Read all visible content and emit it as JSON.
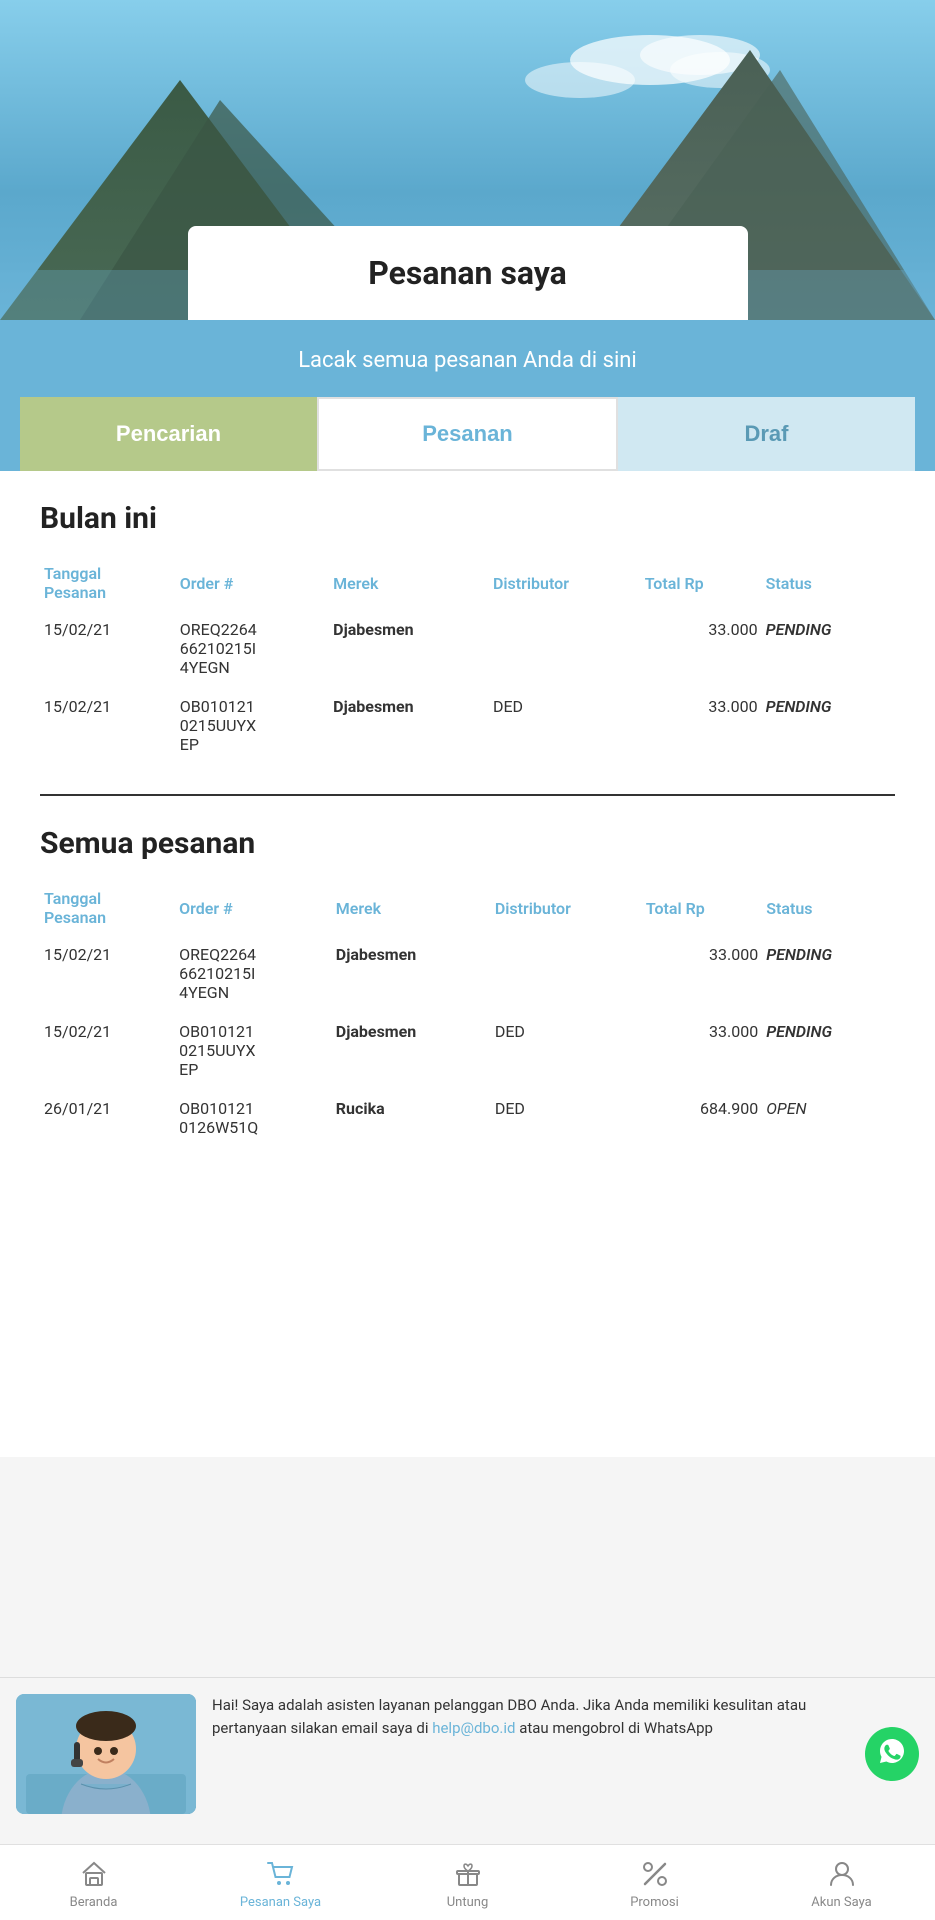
{
  "hero": {
    "title": "Pesanan saya",
    "subtitle": "Lacak semua pesanan Anda di sini"
  },
  "tabs": [
    {
      "id": "pencarian",
      "label": "Pencarian",
      "active": true
    },
    {
      "id": "pesanan",
      "label": "Pesanan",
      "active": false
    },
    {
      "id": "draf",
      "label": "Draf",
      "active": false
    }
  ],
  "sections": [
    {
      "title": "Bulan ini",
      "columns": [
        "Tanggal Pesanan",
        "Order #",
        "Merek",
        "Distributor",
        "Total Rp",
        "Status"
      ],
      "rows": [
        {
          "date": "15/02/21",
          "order_id": "OREQ226466210215I4YEGN",
          "brand": "Djabesmen",
          "distributor": "",
          "total": "33.000",
          "status": "PENDING",
          "status_class": "pending"
        },
        {
          "date": "15/02/21",
          "order_id": "OB0101210215UUYXEP",
          "brand": "Djabesmen",
          "distributor": "DED",
          "total": "33.000",
          "status": "PENDING",
          "status_class": "pending"
        }
      ]
    },
    {
      "title": "Semua pesanan",
      "columns": [
        "Tanggal Pesanan",
        "Order #",
        "Merek",
        "Distributor",
        "Total Rp",
        "Status"
      ],
      "rows": [
        {
          "date": "15/02/21",
          "order_id": "OREQ226466210215I4YEGN",
          "brand": "Djabesmen",
          "distributor": "",
          "total": "33.000",
          "status": "PENDING",
          "status_class": "pending"
        },
        {
          "date": "15/02/21",
          "order_id": "OB0101210215UUYXEP",
          "brand": "Djabesmen",
          "distributor": "DED",
          "total": "33.000",
          "status": "PENDING",
          "status_class": "pending"
        },
        {
          "date": "26/01/21",
          "order_id": "OB0101210126W51Q",
          "brand": "Rucika",
          "distributor": "DED",
          "total": "684.900",
          "status": "OPEN",
          "status_class": "open"
        }
      ]
    }
  ],
  "chat": {
    "message": "Hai! Saya adalah asisten layanan pelanggan DBO Anda. Jika Anda memiliki kesulitan atau pertanyaan silakan email saya di ",
    "email": "help@dbo.id",
    "message_suffix": " atau mengobrol di WhatsApp"
  },
  "nav": [
    {
      "id": "beranda",
      "label": "Beranda",
      "active": false
    },
    {
      "id": "pesanan-saya",
      "label": "Pesanan Saya",
      "active": true
    },
    {
      "id": "untung",
      "label": "Untung",
      "active": false
    },
    {
      "id": "promosi",
      "label": "Promosi",
      "active": false
    },
    {
      "id": "akun-saya",
      "label": "Akun Saya",
      "active": false
    }
  ]
}
